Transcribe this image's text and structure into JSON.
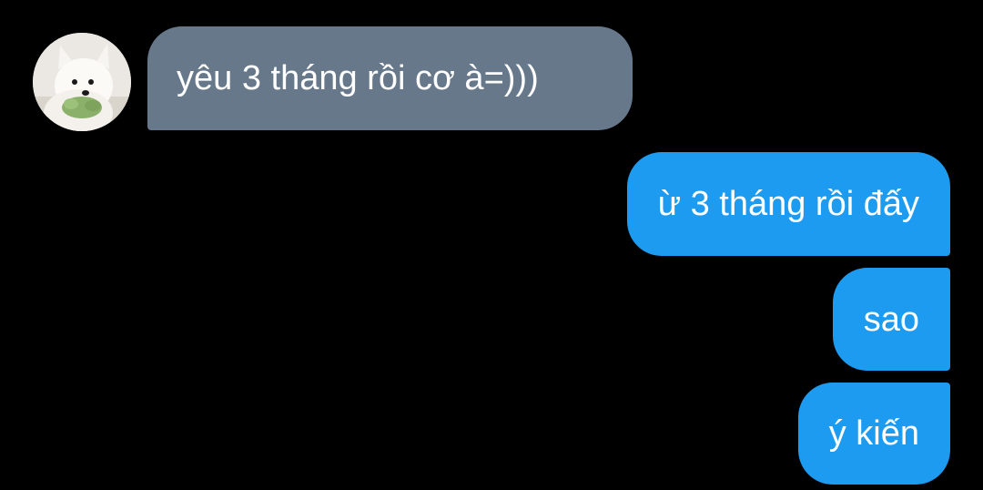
{
  "colors": {
    "background": "#000000",
    "incoming_bubble": "#66788a",
    "outgoing_bubble": "#1d9bf0",
    "text": "#ffffff"
  },
  "contact": {
    "avatar_icon": "white-dog-with-green-toy-avatar"
  },
  "messages": [
    {
      "direction": "incoming",
      "text": "yêu 3 tháng rồi cơ à=)))"
    },
    {
      "direction": "outgoing",
      "text": "ừ 3 tháng rồi đấy"
    },
    {
      "direction": "outgoing",
      "text": "sao"
    },
    {
      "direction": "outgoing",
      "text": "ý kiến"
    }
  ]
}
